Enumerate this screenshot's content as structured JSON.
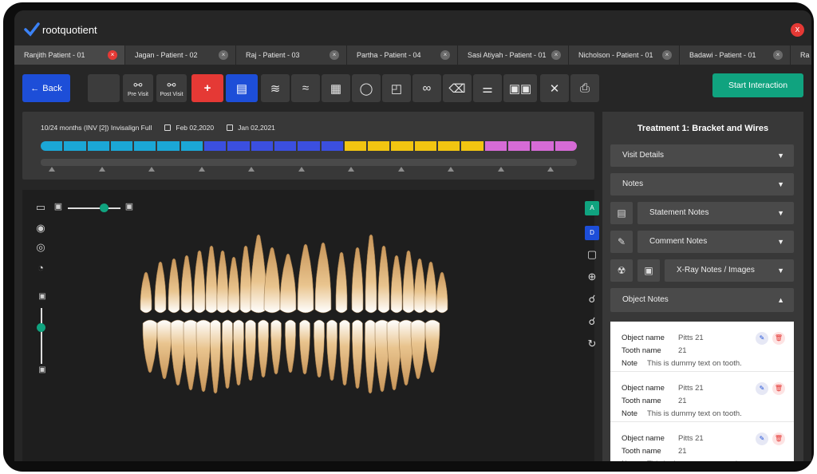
{
  "app": {
    "name": "rootquotient",
    "close_glyph": "x"
  },
  "tabs": [
    {
      "label": "Ranjith  Patient - 01",
      "active": true
    },
    {
      "label": "Jagan - Patient - 02",
      "active": false
    },
    {
      "label": "Raj - Patient - 03",
      "active": false
    },
    {
      "label": "Partha - Patient - 04",
      "active": false
    },
    {
      "label": "Sasi Atiyah - Patient - 01",
      "active": false
    },
    {
      "label": "Nicholson - Patient - 01",
      "active": false
    },
    {
      "label": "Badawi - Patient - 01",
      "active": false
    },
    {
      "label": "Ra",
      "active": false
    }
  ],
  "toolbar": {
    "back_label": "Back",
    "pre_visit_label": "Pre Visit",
    "post_visit_label": "Post Visit",
    "start_interaction_label": "Start Interaction"
  },
  "timeline": {
    "duration": "10/24 months (INV [2]) Invisalign Full",
    "start_date": "Feb 02,2020",
    "end_date": "Jan 02,2021",
    "segments": [
      "#1ba7d6",
      "#1ba7d6",
      "#1ba7d6",
      "#1ba7d6",
      "#1ba7d6",
      "#1ba7d6",
      "#1ba7d6",
      "#3b4fe0",
      "#3b4fe0",
      "#3b4fe0",
      "#3b4fe0",
      "#3b4fe0",
      "#3b4fe0",
      "#f2c511",
      "#f2c511",
      "#f2c511",
      "#f2c511",
      "#f2c511",
      "#f2c511",
      "#d66bd6",
      "#d66bd6",
      "#d66bd6",
      "#d66bd6"
    ]
  },
  "viewer": {
    "view_a_label": "A",
    "view_d_label": "D"
  },
  "panel": {
    "title": "Treatment 1: Bracket and Wires",
    "visit_details": "Visit Details",
    "notes": "Notes",
    "statement_notes": "Statement Notes",
    "comment_notes": "Comment Notes",
    "xray_notes": "X-Ray Notes / Images",
    "object_notes": "Object Notes"
  },
  "object_notes": {
    "labels": {
      "object_name": "Object name",
      "tooth_name": "Tooth name",
      "note": "Note"
    },
    "items": [
      {
        "object_name": "Pitts 21",
        "tooth_name": "21",
        "note": "This is dummy text on tooth."
      },
      {
        "object_name": "Pitts 21",
        "tooth_name": "21",
        "note": "This is dummy text on tooth."
      },
      {
        "object_name": "Pitts 21",
        "tooth_name": "21",
        "note": "This is dummy text on tooth."
      }
    ]
  },
  "colors": {
    "accent_green": "#10a37f",
    "accent_blue": "#1d4ed8",
    "danger_red": "#e53935"
  }
}
